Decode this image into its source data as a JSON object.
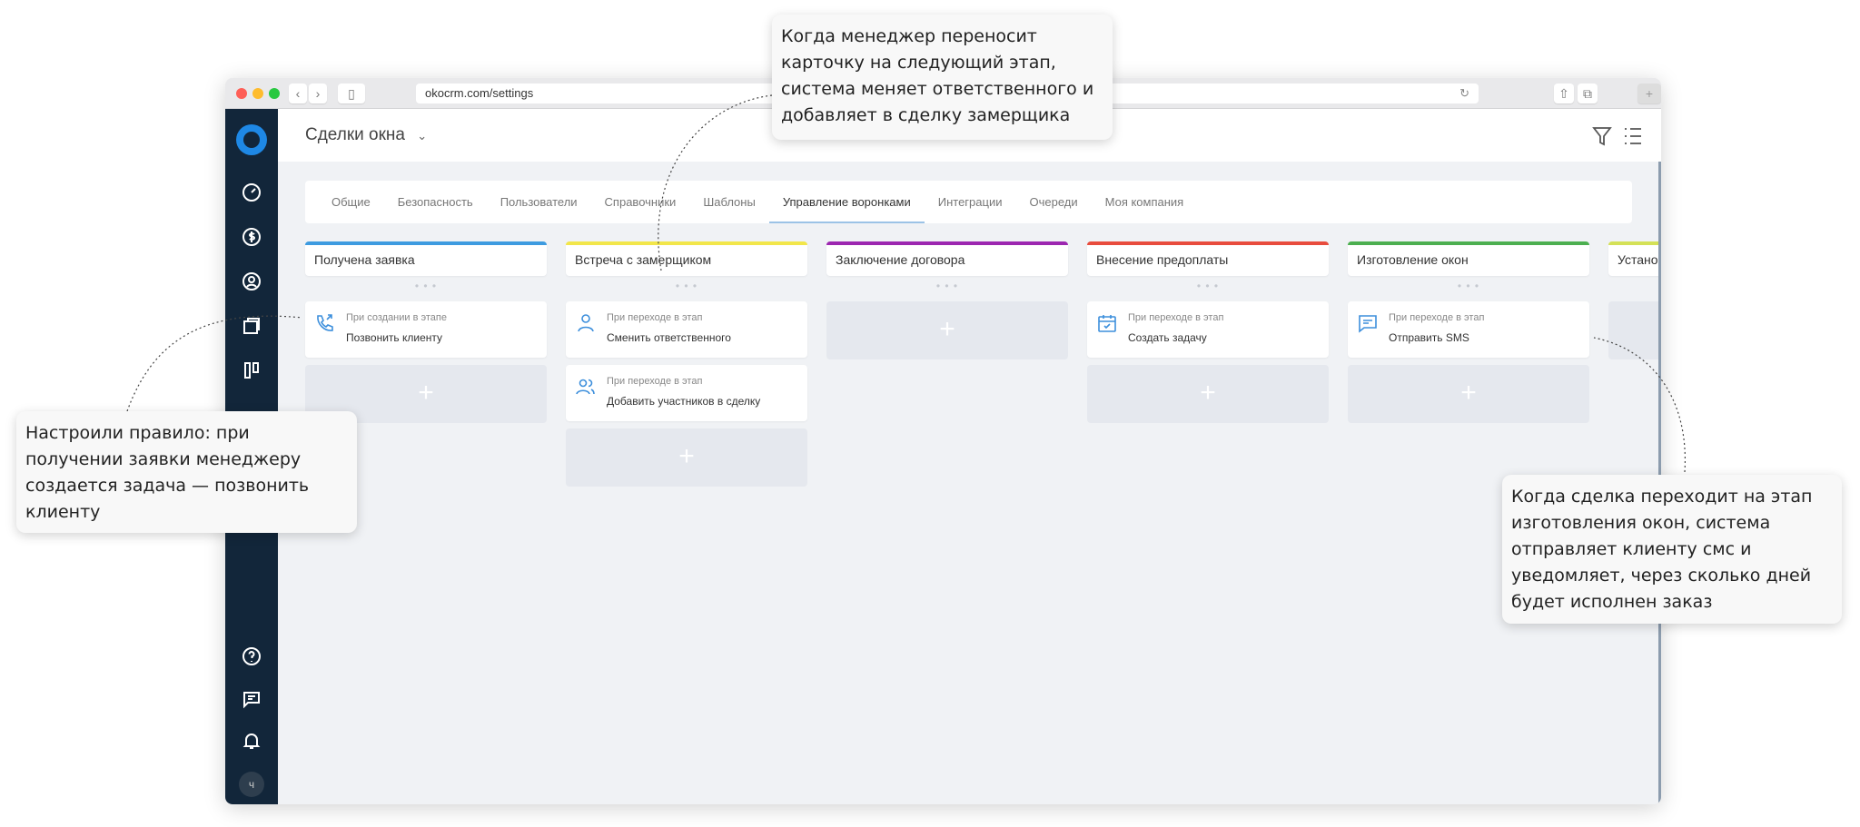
{
  "browser": {
    "url": "okocrm.com/settings"
  },
  "header": {
    "title": "Сделки окна"
  },
  "tabs": [
    "Общие",
    "Безопасность",
    "Пользователи",
    "Справочники",
    "Шаблоны",
    "Управление воронками",
    "Интеграции",
    "Очереди",
    "Моя компания"
  ],
  "active_tab": "Управление воронками",
  "columns": [
    {
      "title": "Получена заявка",
      "color": "#3d9be0",
      "cards": [
        {
          "trigger": "При создании в этапе",
          "action": "Позвонить клиенту",
          "icon": "phone-icon"
        }
      ]
    },
    {
      "title": "Встреча с замерщиком",
      "color": "#f2e64a",
      "cards": [
        {
          "trigger": "При переходе в этап",
          "action": "Сменить ответственного",
          "icon": "user-icon"
        },
        {
          "trigger": "При переходе в этап",
          "action": "Добавить участников в сделку",
          "icon": "users-icon"
        }
      ]
    },
    {
      "title": "Заключение договора",
      "color": "#9c27b0",
      "cards": []
    },
    {
      "title": "Внесение предоплаты",
      "color": "#e84c3d",
      "cards": [
        {
          "trigger": "При переходе в этап",
          "action": "Создать задачу",
          "icon": "calendar-icon"
        }
      ]
    },
    {
      "title": "Изготовление окон",
      "color": "#4caf50",
      "cards": [
        {
          "trigger": "При переходе в этап",
          "action": "Отправить SMS",
          "icon": "message-icon"
        }
      ]
    },
    {
      "title": "Установка",
      "color": "#d4e157",
      "cards": []
    }
  ],
  "sidebar": {
    "avatar": "ч"
  },
  "callouts": {
    "top": [
      "Когда менеджер переносит",
      "карточку на следующий этап,",
      "система меняет ответственного и",
      "добавляет в сделку замерщика"
    ],
    "left": [
      "Настроили правило: при",
      "получении заявки менеджеру",
      "создается задача — позвонить",
      "клиенту"
    ],
    "right": [
      "Когда сделка переходит на этап",
      "изготовления окон, система",
      "отправляет клиенту смс и",
      "уведомляет, через сколько дней",
      "будет исполнен заказ"
    ]
  }
}
